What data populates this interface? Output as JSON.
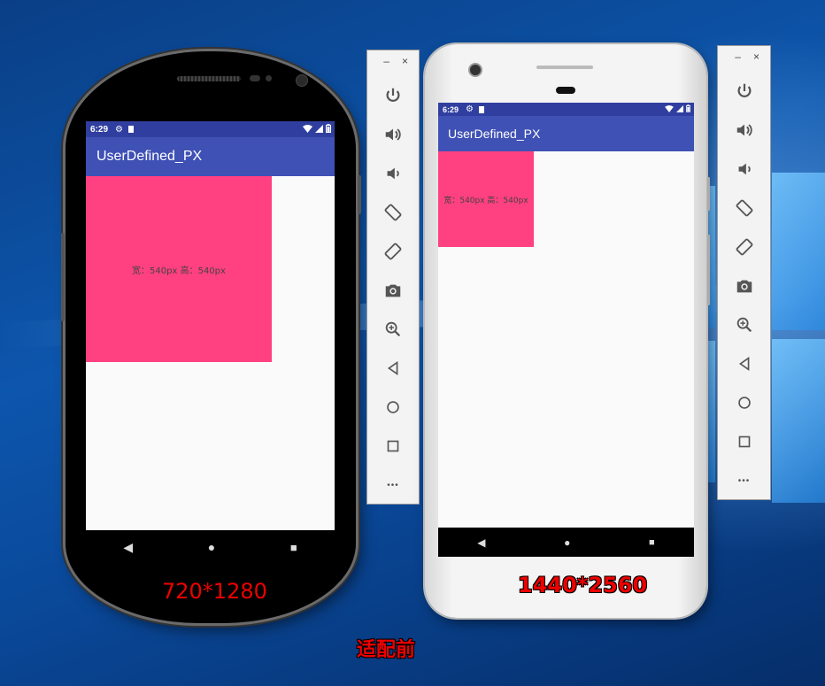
{
  "phone_left": {
    "status": {
      "time": "6:29",
      "gear_icon": "⚙",
      "battery_label": "▮"
    },
    "app_title": "UserDefined_PX",
    "box_text": "宽：540px  高：540px",
    "resolution_label": "720*1280",
    "nav": {
      "back": "◀",
      "home": "●",
      "recents": "■"
    }
  },
  "phone_right": {
    "status": {
      "time": "6:29",
      "gear_icon": "⚙",
      "battery_label": "▮"
    },
    "app_title": "UserDefined_PX",
    "box_text": "宽：540px  高：540px",
    "resolution_label": "1440*2560",
    "nav": {
      "back": "◀",
      "home": "●",
      "recents": "■"
    }
  },
  "toolbar": {
    "minimize": "–",
    "close": "×",
    "more": "•••"
  },
  "caption": "适配前",
  "colors": {
    "primary": "#3f51b5",
    "primary_dark": "#303f9f",
    "accent": "#ff4081",
    "label_red": "#e00000"
  }
}
